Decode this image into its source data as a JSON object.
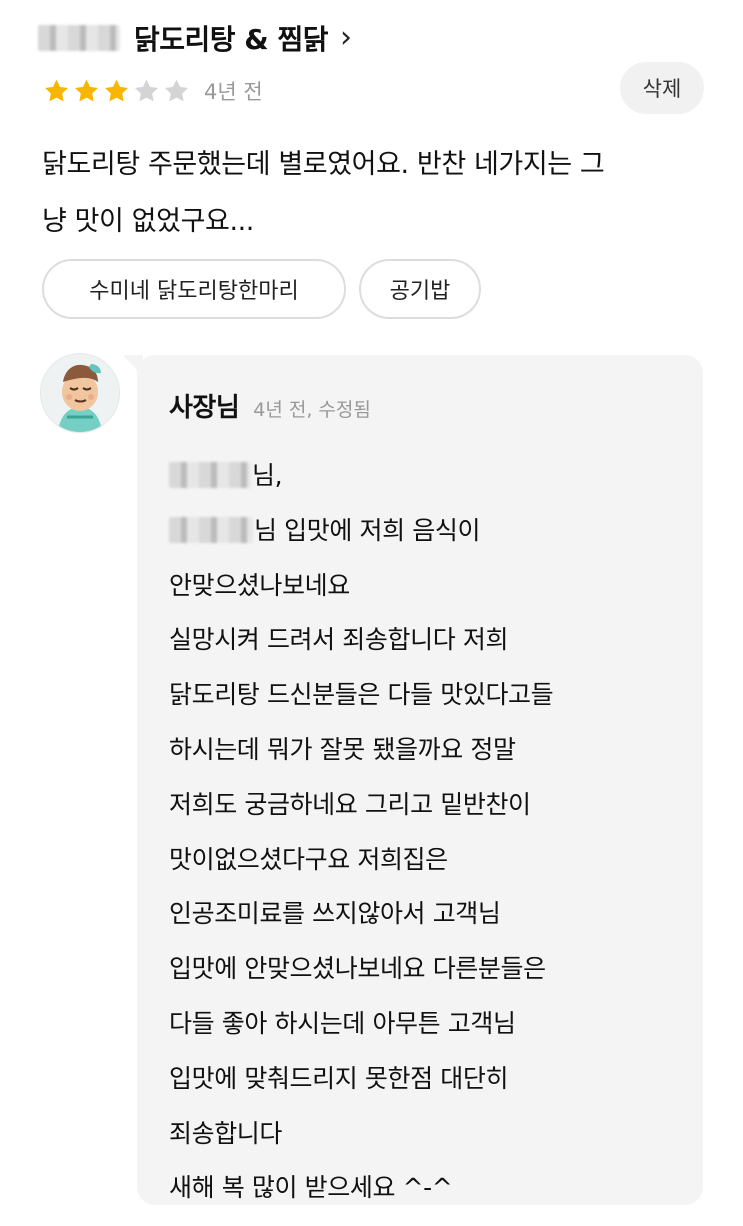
{
  "store": {
    "name": "닭도리탕 & 찜닭",
    "chevron": "›"
  },
  "review": {
    "rating": 3,
    "max_rating": 5,
    "time": "4년 전",
    "delete_label": "삭제",
    "lines": [
      "닭도리탕 주문했는데 별로였어요. 반찬 네가지는 그",
      "냥 맛이 없었구요..."
    ],
    "menu_tags": [
      "수미네 닭도리탕한마리",
      "공기밥"
    ],
    "colors": {
      "star_filled": "#f8b600",
      "star_empty": "#d4d4d4"
    }
  },
  "reply": {
    "author": "사장님",
    "meta": "4년 전, 수정됨",
    "greeting_suffix": "님,",
    "second_line_suffix": "님 입맛에 저희 음식이",
    "lines": [
      "안맞으셨나보네요",
      "실망시켜 드려서 죄송합니다 저희",
      "닭도리탕 드신분들은 다들 맛있다고들",
      "하시는데 뭐가 잘못 됐을까요 정말",
      "저희도 궁금하네요 그리고 밑반찬이",
      "맛이없으셨다구요 저희집은",
      "인공조미료를 쓰지않아서 고객님",
      "입맛에 안맞으셨나보네요 다른분들은",
      "다들 좋아 하시는데 아무튼 고객님",
      "입맛에 맞춰드리지 못한점 대단히",
      "죄송합니다",
      "새해 복 많이 받으세요 ^-^"
    ],
    "bubble_color": "#f4f4f4"
  }
}
